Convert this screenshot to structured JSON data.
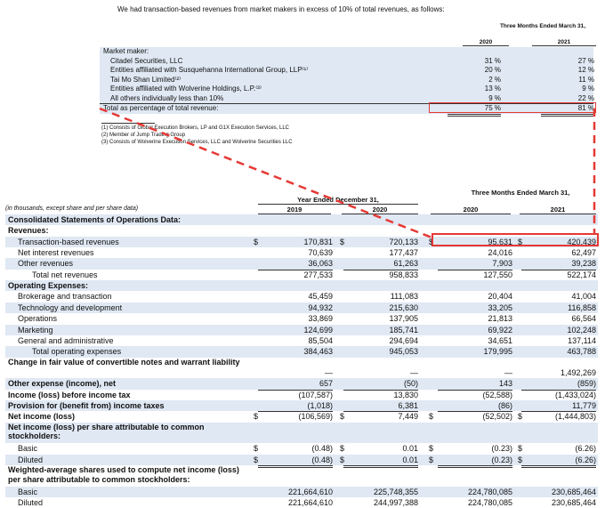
{
  "intro_text": "We had transaction-based revenues from market makers in excess of 10% of total revenues, as follows:",
  "top_table": {
    "period_header": "Three Months Ended March 31,",
    "years": [
      "2020",
      "2021"
    ],
    "section_label": "Market maker:",
    "rows": [
      {
        "label": "Citadel Securities, LLC",
        "v2020": "31 %",
        "v2021": "27 %"
      },
      {
        "label": "Entities affiliated with Susquehanna International Group, LLP⁽¹⁾",
        "v2020": "20 %",
        "v2021": "12 %"
      },
      {
        "label": "Tai Mo Shan Limited⁽²⁾",
        "v2020": "2 %",
        "v2021": "11 %"
      },
      {
        "label": "Entities affiliated with Wolverine Holdings, L.P.⁽³⁾",
        "v2020": "13 %",
        "v2021": "9 %"
      },
      {
        "label": "All others individually less than 10%",
        "v2020": "9 %",
        "v2021": "22 %"
      }
    ],
    "total": {
      "label": "Total as percentage of total revenue:",
      "v2020": "75 %",
      "v2021": "81 %"
    }
  },
  "footnotes": [
    "(1)  Consists of Global Execution Brokers, LP and G1X Execution Services, LLC",
    "(2)  Member of Jump Trading Group",
    "(3)  Consists of Wolverine Execution Services, LLC and Wolverine Securities LLC"
  ],
  "main_table": {
    "unit_note": "(in thousands, except share and per share data)",
    "year_header": "Year Ended December 31,",
    "quarter_header": "Three Months Ended March 31,",
    "columns": [
      "2019",
      "2020",
      "2020",
      "2021"
    ],
    "rows": [
      {
        "label": "Consolidated Statements of Operations Data:",
        "style": "b",
        "vals": [
          "",
          "",
          "",
          ""
        ]
      },
      {
        "label": "Revenues:",
        "style": "b",
        "vals": [
          "",
          "",
          "",
          ""
        ]
      },
      {
        "label": "Transaction-based revenues",
        "style": "i1",
        "dollar": true,
        "vals": [
          "170,831",
          "720,133",
          "95,631",
          "420,439"
        ]
      },
      {
        "label": "Net interest revenues",
        "style": "i1",
        "vals": [
          "70,639",
          "177,437",
          "24,016",
          "62,497"
        ]
      },
      {
        "label": "Other revenues",
        "style": "i1",
        "vals": [
          "36,063",
          "61,263",
          "7,903",
          "39,238"
        ],
        "underline": true
      },
      {
        "label": "Total net revenues",
        "style": "i2",
        "vals": [
          "277,533",
          "958,833",
          "127,550",
          "522,174"
        ]
      },
      {
        "label": "Operating Expenses:",
        "style": "b",
        "vals": [
          "",
          "",
          "",
          ""
        ]
      },
      {
        "label": "Brokerage and transaction",
        "style": "i1",
        "vals": [
          "45,459",
          "111,083",
          "20,404",
          "41,004"
        ]
      },
      {
        "label": "Technology and development",
        "style": "i1",
        "vals": [
          "94,932",
          "215,630",
          "33,205",
          "116,858"
        ]
      },
      {
        "label": "Operations",
        "style": "i1",
        "vals": [
          "33,869",
          "137,905",
          "21,813",
          "66,564"
        ]
      },
      {
        "label": "Marketing",
        "style": "i1",
        "vals": [
          "124,699",
          "185,741",
          "69,922",
          "102,248"
        ]
      },
      {
        "label": "General and administrative",
        "style": "i1",
        "vals": [
          "85,504",
          "294,694",
          "34,651",
          "137,114"
        ],
        "underline": true
      },
      {
        "label": "Total operating expenses",
        "style": "i2",
        "vals": [
          "384,463",
          "945,053",
          "179,995",
          "463,788"
        ]
      },
      {
        "label": "Change in fair value of convertible notes and warrant liability",
        "style": "b2",
        "vals": [
          "—",
          "—",
          "—",
          "1,492,269"
        ]
      },
      {
        "label": "Other expense (income), net",
        "style": "b",
        "vals": [
          "657",
          "(50)",
          "143",
          "(859)"
        ],
        "underline": true
      },
      {
        "label": "Income (loss) before income tax",
        "style": "b",
        "vals": [
          "(107,587)",
          "13,830",
          "(52,588)",
          "(1,433,024)"
        ]
      },
      {
        "label": "Provision for (benefit from) income taxes",
        "style": "b",
        "vals": [
          "(1,018)",
          "6,381",
          "(86)",
          "11,779"
        ],
        "underline": true
      },
      {
        "label": "Net income (loss)",
        "style": "b",
        "dollar": true,
        "vals": [
          "(106,569)",
          "7,449",
          "(52,502)",
          "(1,444,803)"
        ],
        "double": true
      },
      {
        "label": "Net income (loss) per share attributable to common stockholders:",
        "style": "b2",
        "vals": [
          "",
          "",
          "",
          ""
        ]
      },
      {
        "label": "Basic",
        "style": "i1",
        "dollar": true,
        "vals": [
          "(0.48)",
          "0.01",
          "(0.23)",
          "(6.26)"
        ],
        "double": true
      },
      {
        "label": "Diluted",
        "style": "i1",
        "dollar": true,
        "vals": [
          "(0.48)",
          "0.01",
          "(0.23)",
          "(6.26)"
        ],
        "double": true
      },
      {
        "label": "Weighted-average shares used to compute net income (loss) per share attributable to common stockholders:",
        "style": "b2",
        "vals": [
          "",
          "",
          "",
          ""
        ]
      },
      {
        "label": "Basic",
        "style": "i1",
        "vals": [
          "221,664,610",
          "225,748,355",
          "224,780,085",
          "230,685,464"
        ]
      },
      {
        "label": "Diluted",
        "style": "i1",
        "vals": [
          "221,664,610",
          "244,997,388",
          "224,780,085",
          "230,685,464"
        ]
      }
    ]
  },
  "currency_symbol": "$",
  "highlight_color": "#e53935",
  "shade_color": "#dfe8f3"
}
